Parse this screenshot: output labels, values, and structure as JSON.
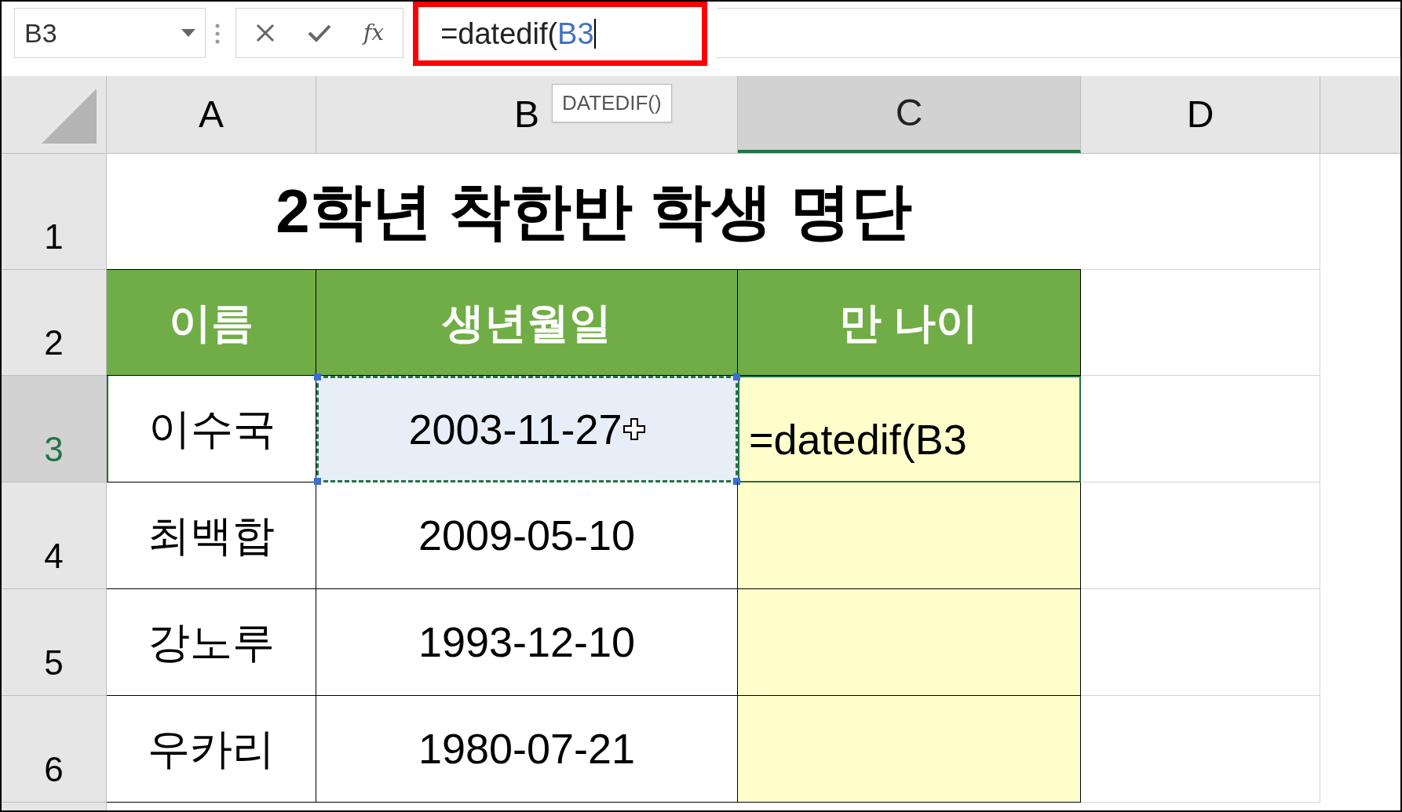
{
  "name_box": "B3",
  "function_button": "fx",
  "formula_bar": {
    "text": "=datedif(",
    "reference": "B3",
    "highlighted": true
  },
  "tooltip": "DATEDIF()",
  "columns": [
    {
      "label": "A",
      "selected": false
    },
    {
      "label": "B",
      "selected": false
    },
    {
      "label": "C",
      "selected": true
    },
    {
      "label": "D",
      "selected": false
    }
  ],
  "rows": [
    {
      "kind": "title",
      "header": "1",
      "selected": false,
      "text": "2학년 착한반 학생 명단"
    },
    {
      "kind": "header",
      "header": "2",
      "selected": false,
      "cells": [
        "이름",
        "생년월일",
        "만 나이"
      ]
    },
    {
      "kind": "data",
      "header": "3",
      "selected": true,
      "name": "이수국",
      "birth": "2003-11-27",
      "age": "=datedif(B3",
      "referenced": true,
      "editing": true
    },
    {
      "kind": "data",
      "header": "4",
      "selected": false,
      "name": "최백합",
      "birth": "2009-05-10",
      "referenced": false,
      "editing": false
    },
    {
      "kind": "data",
      "header": "5",
      "selected": false,
      "name": "강노루",
      "birth": "1993-12-10",
      "referenced": false,
      "editing": false
    },
    {
      "kind": "data",
      "header": "6",
      "selected": false,
      "name": "우카리",
      "birth": "1980-07-21",
      "referenced": false,
      "editing": false
    }
  ]
}
